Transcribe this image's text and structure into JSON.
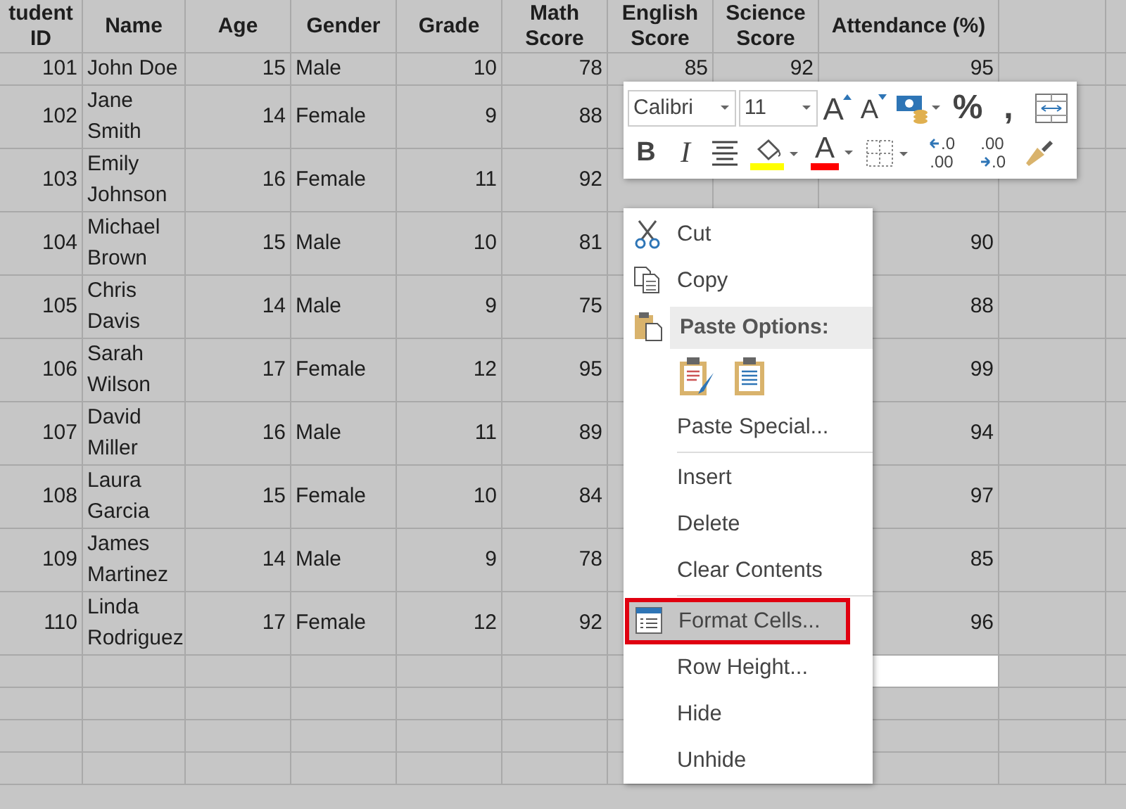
{
  "columns": [
    {
      "label": "tudent ID",
      "kind": "number"
    },
    {
      "label": "Name",
      "kind": "text"
    },
    {
      "label": "Age",
      "kind": "number"
    },
    {
      "label": "Gender",
      "kind": "text"
    },
    {
      "label": "Grade",
      "kind": "number"
    },
    {
      "label": "Math Score",
      "kind": "number"
    },
    {
      "label": "English Score",
      "kind": "number"
    },
    {
      "label": "Science Score",
      "kind": "number"
    },
    {
      "label": "Attendance (%)",
      "kind": "number"
    }
  ],
  "rows": [
    {
      "cells": [
        "101",
        "John Doe",
        "15",
        "Male",
        "10",
        "78",
        "85",
        "92",
        "95"
      ]
    },
    {
      "cells": [
        "102",
        "Jane Smith",
        "14",
        "Female",
        "9",
        "88",
        null,
        null,
        null
      ]
    },
    {
      "cells": [
        "103",
        "Emily Johnson",
        "16",
        "Female",
        "11",
        "92",
        null,
        null,
        null
      ]
    },
    {
      "cells": [
        "104",
        "Michael Brown",
        "15",
        "Male",
        "10",
        "81",
        null,
        null,
        "90"
      ]
    },
    {
      "cells": [
        "105",
        "Chris Davis",
        "14",
        "Male",
        "9",
        "75",
        null,
        null,
        "88"
      ]
    },
    {
      "cells": [
        "106",
        "Sarah Wilson",
        "17",
        "Female",
        "12",
        "95",
        null,
        null,
        "99"
      ]
    },
    {
      "cells": [
        "107",
        "David Miller",
        "16",
        "Male",
        "11",
        "89",
        null,
        null,
        "94"
      ]
    },
    {
      "cells": [
        "108",
        "Laura Garcia",
        "15",
        "Female",
        "10",
        "84",
        null,
        null,
        "97"
      ]
    },
    {
      "cells": [
        "109",
        "James Martinez",
        "14",
        "Male",
        "9",
        "78",
        null,
        null,
        "85"
      ]
    },
    {
      "cells": [
        "110",
        "Linda Rodriguez",
        "17",
        "Female",
        "12",
        "92",
        null,
        null,
        "96"
      ]
    }
  ],
  "blank_rows": [
    {
      "selected": false
    },
    {
      "selected": true
    },
    {
      "selected": true
    },
    {
      "selected": true
    }
  ],
  "toolbar": {
    "row1": [
      {
        "kind": "font-box",
        "value": "Calibri"
      },
      {
        "kind": "size-box",
        "value": "11"
      },
      {
        "kind": "grow",
        "label": "A"
      },
      {
        "kind": "shrink",
        "label": "A"
      },
      {
        "kind": "accounting"
      },
      {
        "kind": "glyph",
        "label": "%"
      },
      {
        "kind": "glyph",
        "label": ","
      },
      {
        "kind": "wrap"
      }
    ],
    "row2": [
      {
        "kind": "bold",
        "label": "B"
      },
      {
        "kind": "italic",
        "label": "I"
      },
      {
        "kind": "align"
      },
      {
        "kind": "fill",
        "color": "#ffff00"
      },
      {
        "kind": "font-color",
        "label": "A",
        "color": "#ff0000"
      },
      {
        "kind": "borders"
      },
      {
        "kind": "decimal-up",
        "top": ".0",
        "bottom": ".00"
      },
      {
        "kind": "decimal-down",
        "top": ".00",
        "bottom": ".0"
      },
      {
        "kind": "painter"
      }
    ]
  },
  "menu": [
    {
      "kind": "cut",
      "label": "Cut",
      "selected": false
    },
    {
      "kind": "copy",
      "label": "Copy",
      "selected": false
    },
    {
      "kind": "paste-header",
      "label": "Paste Options:"
    },
    {
      "kind": "paste-buttons"
    },
    {
      "kind": "plain",
      "label": "Paste Special...",
      "selected": false
    },
    {
      "kind": "separator"
    },
    {
      "kind": "plain",
      "label": "Insert",
      "selected": false
    },
    {
      "kind": "plain",
      "label": "Delete",
      "selected": false
    },
    {
      "kind": "plain",
      "label": "Clear Contents",
      "selected": false
    },
    {
      "kind": "separator"
    },
    {
      "kind": "format",
      "label": "Format Cells...",
      "selected": true
    },
    {
      "kind": "plain",
      "label": "Row Height...",
      "selected": false
    },
    {
      "kind": "plain",
      "label": "Hide",
      "selected": false
    },
    {
      "kind": "plain",
      "label": "Unhide",
      "selected": false
    }
  ]
}
